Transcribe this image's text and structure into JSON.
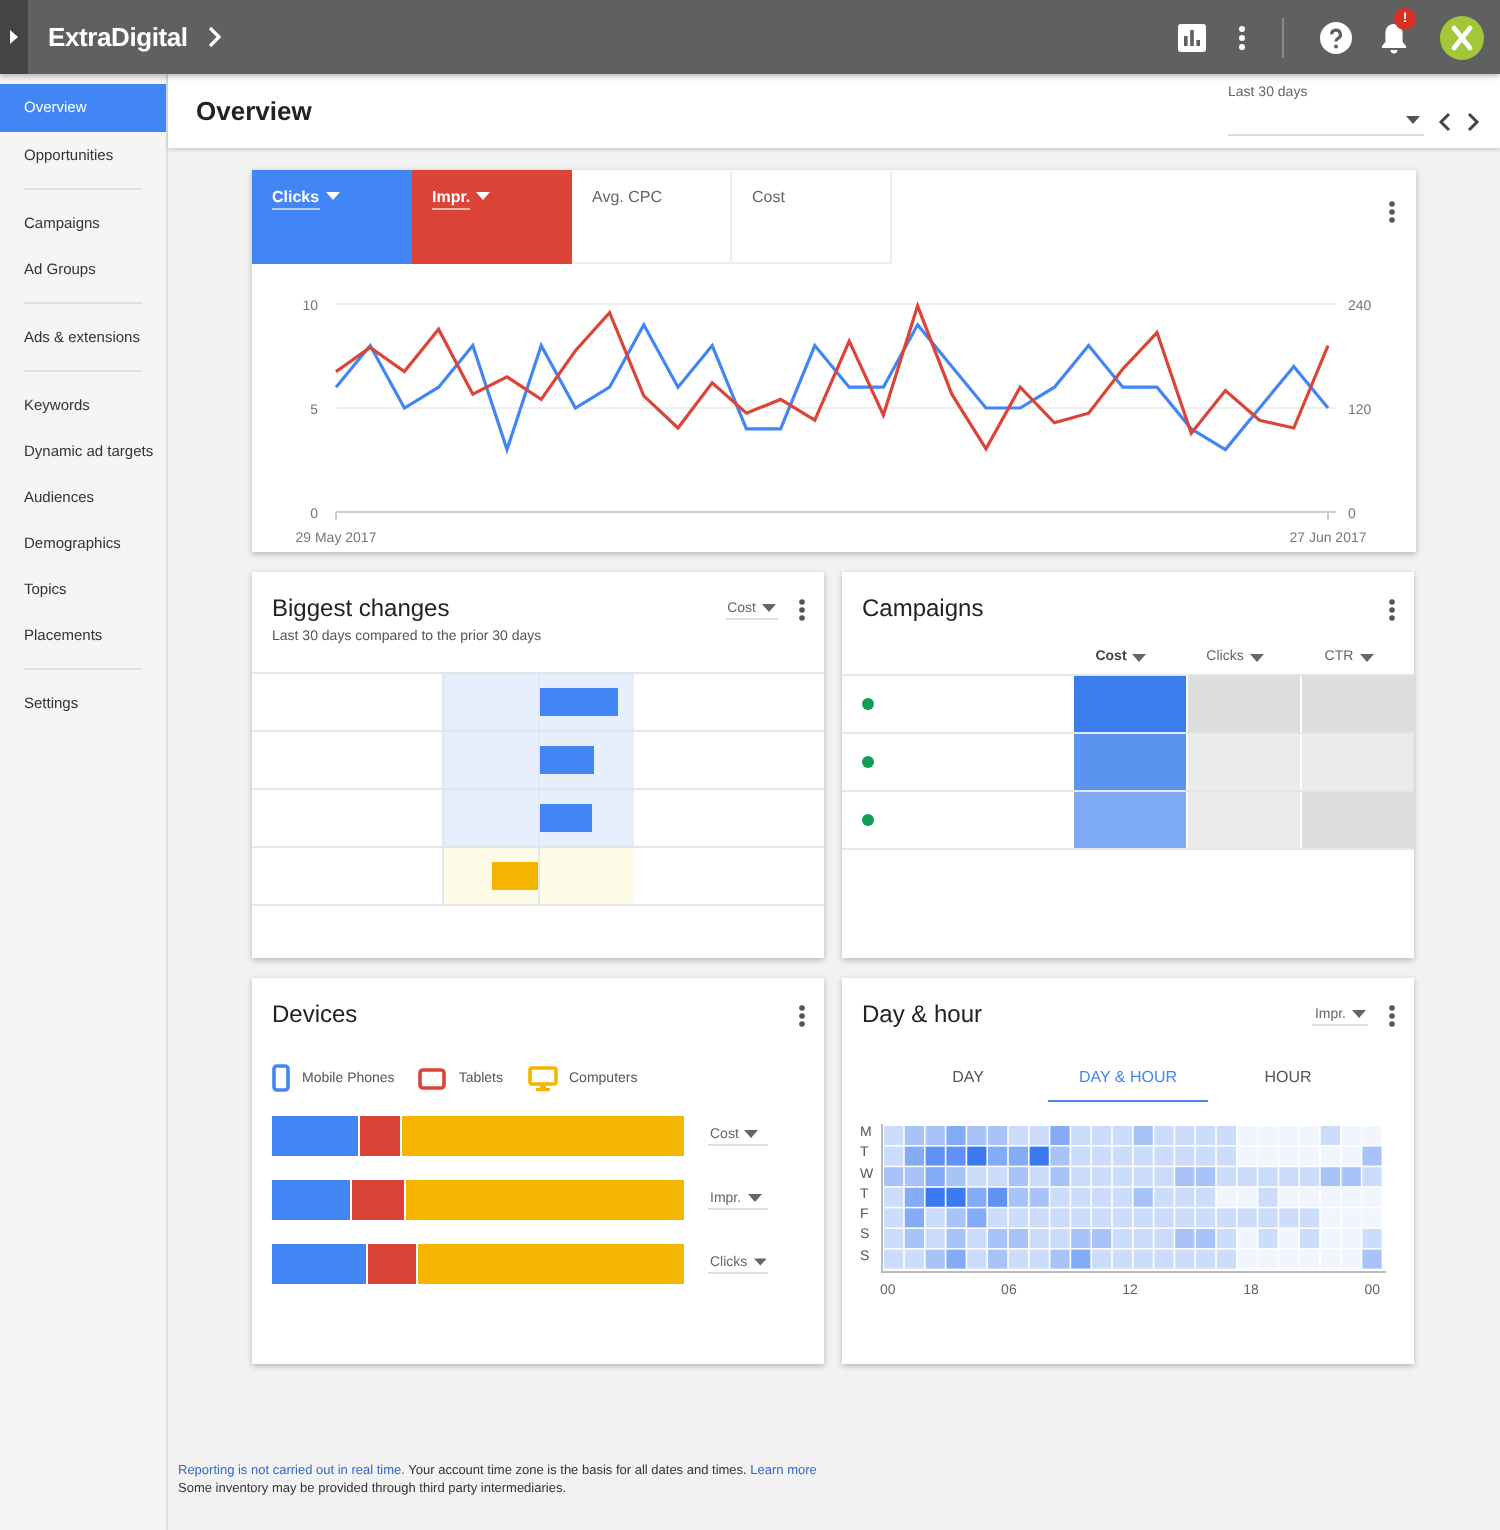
{
  "header": {
    "brand": "ExtraDigital",
    "notification_badge": "!"
  },
  "sidebar": {
    "groups": [
      [
        {
          "label": "Overview",
          "selected": true
        },
        {
          "label": "Opportunities",
          "selected": false
        }
      ],
      [
        {
          "label": "Campaigns",
          "selected": false
        },
        {
          "label": "Ad Groups",
          "selected": false
        }
      ],
      [
        {
          "label": "Ads & extensions",
          "selected": false
        }
      ],
      [
        {
          "label": "Keywords",
          "selected": false
        },
        {
          "label": "Dynamic ad targets",
          "selected": false
        },
        {
          "label": "Audiences",
          "selected": false
        },
        {
          "label": "Demographics",
          "selected": false
        },
        {
          "label": "Topics",
          "selected": false
        },
        {
          "label": "Placements",
          "selected": false
        }
      ],
      [
        {
          "label": "Settings",
          "selected": false
        }
      ]
    ]
  },
  "page": {
    "title": "Overview",
    "date_range": {
      "label": "Last 30 days"
    }
  },
  "performance_card": {
    "metrics": [
      {
        "label": "Clicks",
        "selected": true,
        "color": "#4285f4"
      },
      {
        "label": "Impr.",
        "selected": true,
        "color": "#db4437"
      },
      {
        "label": "Avg. CPC",
        "selected": false
      },
      {
        "label": "Cost",
        "selected": false
      }
    ],
    "chart_data": {
      "type": "line",
      "categories": [
        "29 May 2017",
        null,
        null,
        null,
        null,
        null,
        null,
        null,
        null,
        null,
        null,
        null,
        null,
        null,
        null,
        null,
        null,
        null,
        null,
        null,
        null,
        null,
        null,
        null,
        null,
        null,
        null,
        null,
        null,
        "27 Jun 2017"
      ],
      "ylim": [
        0,
        10
      ],
      "yticks": [
        0,
        5,
        10
      ],
      "y2lim": [
        0,
        240
      ],
      "y2ticks": [
        0,
        120,
        240
      ],
      "series": [
        {
          "color": "#4285f4",
          "values": [
            6,
            8,
            5,
            6,
            8,
            3,
            8,
            5,
            6,
            9,
            6,
            8,
            4,
            4,
            8,
            6,
            6,
            9,
            7,
            5,
            5,
            6,
            8,
            6,
            6,
            4,
            3,
            5,
            7,
            5
          ]
        },
        {
          "color": "#db4437",
          "axis": "y2",
          "values": [
            162,
            190,
            162,
            211,
            136,
            156,
            130,
            186,
            230,
            134,
            97,
            149,
            114,
            130,
            106,
            197,
            112,
            238,
            136,
            73,
            144,
            103,
            114,
            165,
            207,
            91,
            140,
            106,
            97,
            192
          ]
        }
      ]
    }
  },
  "biggest_changes": {
    "title": "Biggest changes",
    "subtitle": "Last 30 days compared to the prior 30 days",
    "metric": "Cost",
    "rows": [
      {
        "kind": "increase",
        "level": 0.82
      },
      {
        "kind": "increase",
        "level": 0.57
      },
      {
        "kind": "increase",
        "level": 0.55
      },
      {
        "kind": "decrease",
        "level": 0.48
      }
    ]
  },
  "campaigns": {
    "title": "Campaigns",
    "columns": [
      {
        "label": "Cost",
        "selected": true
      },
      {
        "label": "Clicks",
        "selected": false
      },
      {
        "label": "CTR",
        "selected": false
      }
    ],
    "rows": [
      {
        "color": "#0f9d58",
        "cells": [
          {
            "color": "#3b7ded"
          },
          {
            "color": "#dddddd"
          },
          {
            "color": "#dddddd"
          }
        ]
      },
      {
        "color": "#0f9d58",
        "cells": [
          {
            "color": "#5a93f0"
          },
          {
            "color": "#ebebeb"
          },
          {
            "color": "#ebebeb"
          }
        ]
      },
      {
        "color": "#0f9d58",
        "cells": [
          {
            "color": "#7fabf5"
          },
          {
            "color": "#ebebeb"
          },
          {
            "color": "#dddddd"
          }
        ]
      }
    ]
  },
  "devices": {
    "title": "Devices",
    "legend": [
      {
        "label": "Mobile Phones",
        "kind": "phone",
        "color": "#4285f4"
      },
      {
        "label": "Tablets",
        "kind": "tablet",
        "color": "#db4437"
      },
      {
        "label": "Computers",
        "kind": "computer",
        "color": "#f4b400"
      }
    ],
    "bars": [
      {
        "metric": "Cost"
      },
      {
        "metric": "Impr."
      },
      {
        "metric": "Clicks"
      }
    ]
  },
  "day_hour": {
    "title": "Day & hour",
    "metric": "Impr.",
    "tabs": [
      {
        "label": "DAY",
        "selected": false
      },
      {
        "label": "DAY & HOUR",
        "selected": true
      },
      {
        "label": "HOUR",
        "selected": false
      }
    ],
    "days": [
      "M",
      "T",
      "W",
      "T",
      "F",
      "S",
      "S"
    ],
    "hours": [
      "00",
      "06",
      "12",
      "18",
      "00"
    ]
  },
  "footer": {
    "link": "Reporting is not carried out in real time.",
    "text": "Your account time zone is the basis for all dates and times.",
    "link_2": "Learn more",
    "note": "Some inventory may be provided through third party intermediaries."
  }
}
